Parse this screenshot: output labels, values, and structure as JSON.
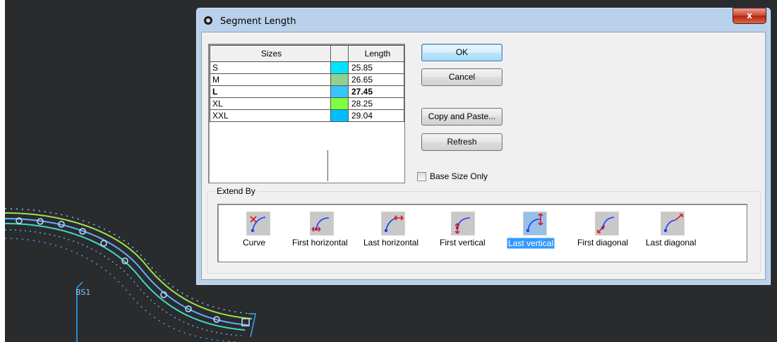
{
  "dialog": {
    "title": "Segment Length",
    "close_label": "x"
  },
  "table": {
    "headers": {
      "size": "Sizes",
      "color": "",
      "length": "Length"
    },
    "rows": [
      {
        "size": "S",
        "length": "25.85",
        "color": "#00e5ff",
        "bold": false
      },
      {
        "size": "M",
        "length": "26.65",
        "color": "#8fd18f",
        "bold": false
      },
      {
        "size": "L",
        "length": "27.45",
        "color": "#38c4ff",
        "bold": true
      },
      {
        "size": "XL",
        "length": "28.25",
        "color": "#80ff40",
        "bold": false
      },
      {
        "size": "XXL",
        "length": "29.04",
        "color": "#00bfff",
        "bold": false
      }
    ]
  },
  "buttons": {
    "ok": "OK",
    "cancel": "Cancel",
    "copy_paste": "Copy and Paste...",
    "refresh": "Refresh"
  },
  "base_size_only": {
    "label": "Base Size Only",
    "checked": false
  },
  "extend_by": {
    "title": "Extend By",
    "options": [
      {
        "label": "Curve",
        "icon": "curve-extend-icon",
        "selected": false
      },
      {
        "label": "First horizontal",
        "icon": "first-horizontal-extend-icon",
        "selected": false
      },
      {
        "label": "Last horizontal",
        "icon": "last-horizontal-extend-icon",
        "selected": false
      },
      {
        "label": "First vertical",
        "icon": "first-vertical-extend-icon",
        "selected": false
      },
      {
        "label": "Last vertical",
        "icon": "last-vertical-extend-icon",
        "selected": true
      },
      {
        "label": "First diagonal",
        "icon": "first-diagonal-extend-icon",
        "selected": false
      },
      {
        "label": "Last diagonal",
        "icon": "last-diagonal-extend-icon",
        "selected": false
      }
    ]
  },
  "workspace": {
    "marker_label": "BS1"
  }
}
